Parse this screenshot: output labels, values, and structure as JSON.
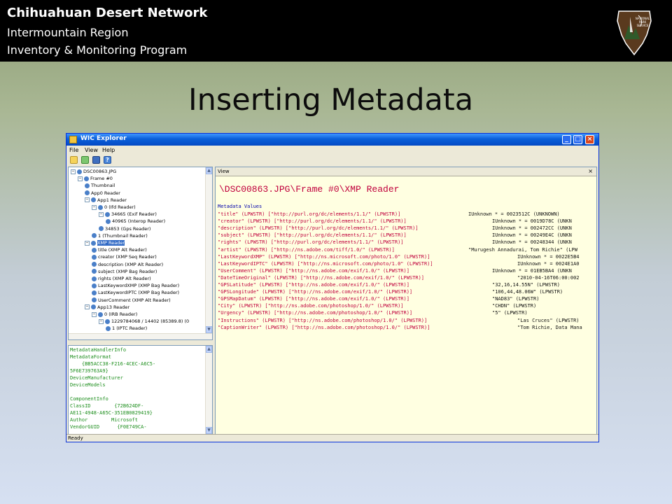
{
  "header": {
    "line1": "Chihuahuan Desert Network",
    "line2": "Intermountain Region",
    "line3": "Inventory & Monitoring Program",
    "logo_text": "NATIONAL PARK SERVICE"
  },
  "slide_title": "Inserting Metadata",
  "window": {
    "title": "WIC Explorer",
    "menu": [
      "File",
      "View",
      "Help"
    ],
    "status": "Ready",
    "view_label": "View",
    "view_close": "×"
  },
  "tree": [
    {
      "text": "DSC00863.JPG",
      "level": 0,
      "expander": "−"
    },
    {
      "text": "Frame #0",
      "level": 1,
      "expander": "−"
    },
    {
      "text": "Thumbnail",
      "level": 2,
      "expander": ""
    },
    {
      "text": "App0 Reader",
      "level": 2,
      "expander": ""
    },
    {
      "text": "App1 Reader",
      "level": 2,
      "expander": "−"
    },
    {
      "text": "0 (Ifd Reader)",
      "level": 3,
      "expander": "−"
    },
    {
      "text": "34665 (Exif Reader)",
      "level": 4,
      "expander": "−"
    },
    {
      "text": "40965 (Interop Reader)",
      "level": 5,
      "expander": ""
    },
    {
      "text": "34853 (Gps Reader)",
      "level": 4,
      "expander": ""
    },
    {
      "text": "1 (Thumbnail Reader)",
      "level": 3,
      "expander": ""
    },
    {
      "text": "XMP Reader",
      "level": 2,
      "expander": "−",
      "selected": true
    },
    {
      "text": "title (XMP Alt Reader)",
      "level": 3,
      "expander": ""
    },
    {
      "text": "creator (XMP Seq Reader)",
      "level": 3,
      "expander": ""
    },
    {
      "text": "description (XMP Alt Reader)",
      "level": 3,
      "expander": ""
    },
    {
      "text": "subject (XMP Bag Reader)",
      "level": 3,
      "expander": ""
    },
    {
      "text": "rights (XMP Alt Reader)",
      "level": 3,
      "expander": ""
    },
    {
      "text": "LastKeywordXMP (XMP Bag Reader)",
      "level": 3,
      "expander": ""
    },
    {
      "text": "LastKeywordIPTC (XMP Bag Reader)",
      "level": 3,
      "expander": ""
    },
    {
      "text": "UserComment (XMP Alt Reader)",
      "level": 3,
      "expander": ""
    },
    {
      "text": "App13 Reader",
      "level": 2,
      "expander": "−"
    },
    {
      "text": "0 (IRB Reader)",
      "level": 3,
      "expander": "−"
    },
    {
      "text": "1229784068 / 14402 (85389.8) (0",
      "level": 4,
      "expander": "−"
    },
    {
      "text": "1 (IPTC Reader)",
      "level": 5,
      "expander": ""
    }
  ],
  "info_lines": [
    "MetadataHandlerInfo",
    "MetadataFormat",
    "    {BB5ACC38-F216-4CEC-A6C5-",
    "5F6E739763A9}",
    "DeviceManufacturer",
    "DeviceModels",
    "",
    "ComponentInfo",
    "ClassID        {72B624DF-",
    "AE11-4948-A65C-351EB0829419}",
    "Author        Microsoft",
    "VendorGUID      {F0E749CA-"
  ],
  "view": {
    "path": "\\DSC00863.JPG\\Frame #0\\XMP Reader",
    "subheading": "Metadata Values",
    "rows": [
      {
        "key": "\"title\" (LPWSTR) [\"http://purl.org/dc/elements/1.1/\" (LPWSTR)]",
        "value": "IUnknown * = 0023512C (UNKNOWN)",
        "offset": 358
      },
      {
        "key": "\"creator\" (LPWSTR) [\"http://purl.org/dc/elements/1.1/\" (LPWSTR)]",
        "value": "IUnknown * = 0019D78C (UNKN",
        "offset": 392
      },
      {
        "key": "\"description\" (LPWSTR) [\"http://purl.org/dc/elements/1.1/\" (LPWSTR)]",
        "value": "IUnknown * = 002472CC (UNKN",
        "offset": 392
      },
      {
        "key": "\"subject\" (LPWSTR) [\"http://purl.org/dc/elements/1.1/\" (LPWSTR)]",
        "value": "IUnknown * = 00249E4C (UNKN",
        "offset": 392
      },
      {
        "key": "\"rights\" (LPWSTR) [\"http://purl.org/dc/elements/1.1/\" (LPWSTR)]",
        "value": "IUnknown * = 00248344 (UNKN",
        "offset": 392
      },
      {
        "key": "\"artist\" (LPWSTR) [\"http://ns.adobe.com/tiff/1.0/\" (LPWSTR)]",
        "value": "\"Murugesh Annadurai, Tom Richie\" (LPW",
        "offset": 358
      },
      {
        "key": "\"LastKeywordXMP\" (LPWSTR) [\"http://ns.microsoft.com/photo/1.0\" (LPWSTR)]",
        "value": "IUnknown * = 0022E5B4",
        "offset": 428
      },
      {
        "key": "\"LastKeywordIPTC\" (LPWSTR) [\"http://ns.microsoft.com/photo/1.0\" (LPWSTR)]",
        "value": "IUnknown * = 0024E1A0",
        "offset": 428
      },
      {
        "key": "\"UserComment\" (LPWSTR) [\"http://ns.adobe.com/exif/1.0/\" (LPWSTR)]",
        "value": "IUnknown * = 01EB5BA4 (UNKN",
        "offset": 392
      },
      {
        "key": "\"DateTimeOriginal\" (LPWSTR) [\"http://ns.adobe.com/exif/1.0/\" (LPWSTR)]",
        "value": "\"2010-04-16T06:00:002",
        "offset": 428
      },
      {
        "key": "\"GPSLatitude\" (LPWSTR) [\"http://ns.adobe.com/exif/1.0/\" (LPWSTR)]",
        "value": "\"32,16,14.55N\" (LPWSTR)",
        "offset": 392
      },
      {
        "key": "\"GPSLongitude\" (LPWSTR) [\"http://ns.adobe.com/exif/1.0/\" (LPWSTR)]",
        "value": "\"106,44,48.06W\" (LPWSTR)",
        "offset": 392
      },
      {
        "key": "\"GPSMapDatum\" (LPWSTR) [\"http://ns.adobe.com/exif/1.0/\" (LPWSTR)]",
        "value": "\"NAD83\" (LPWSTR)",
        "offset": 392
      },
      {
        "key": "\"City\" (LPWSTR) [\"http://ns.adobe.com/photoshop/1.0/\" (LPWSTR)]",
        "value": "\"CHDN\" (LPWSTR)",
        "offset": 392
      },
      {
        "key": "\"Urgency\" (LPWSTR) [\"http://ns.adobe.com/photoshop/1.0/\" (LPWSTR)]",
        "value": "\"5\" (LPWSTR)",
        "offset": 392
      },
      {
        "key": "\"Instructions\" (LPWSTR) [\"http://ns.adobe.com/photoshop/1.0/\" (LPWSTR)]",
        "value": "\"Las Cruces\" (LPWSTR)",
        "offset": 428
      },
      {
        "key": "\"CaptionWriter\" (LPWSTR) [\"http://ns.adobe.com/photoshop/1.0/\" (LPWSTR)]",
        "value": "\"Tom Richie, Data Mana",
        "offset": 428
      }
    ]
  }
}
